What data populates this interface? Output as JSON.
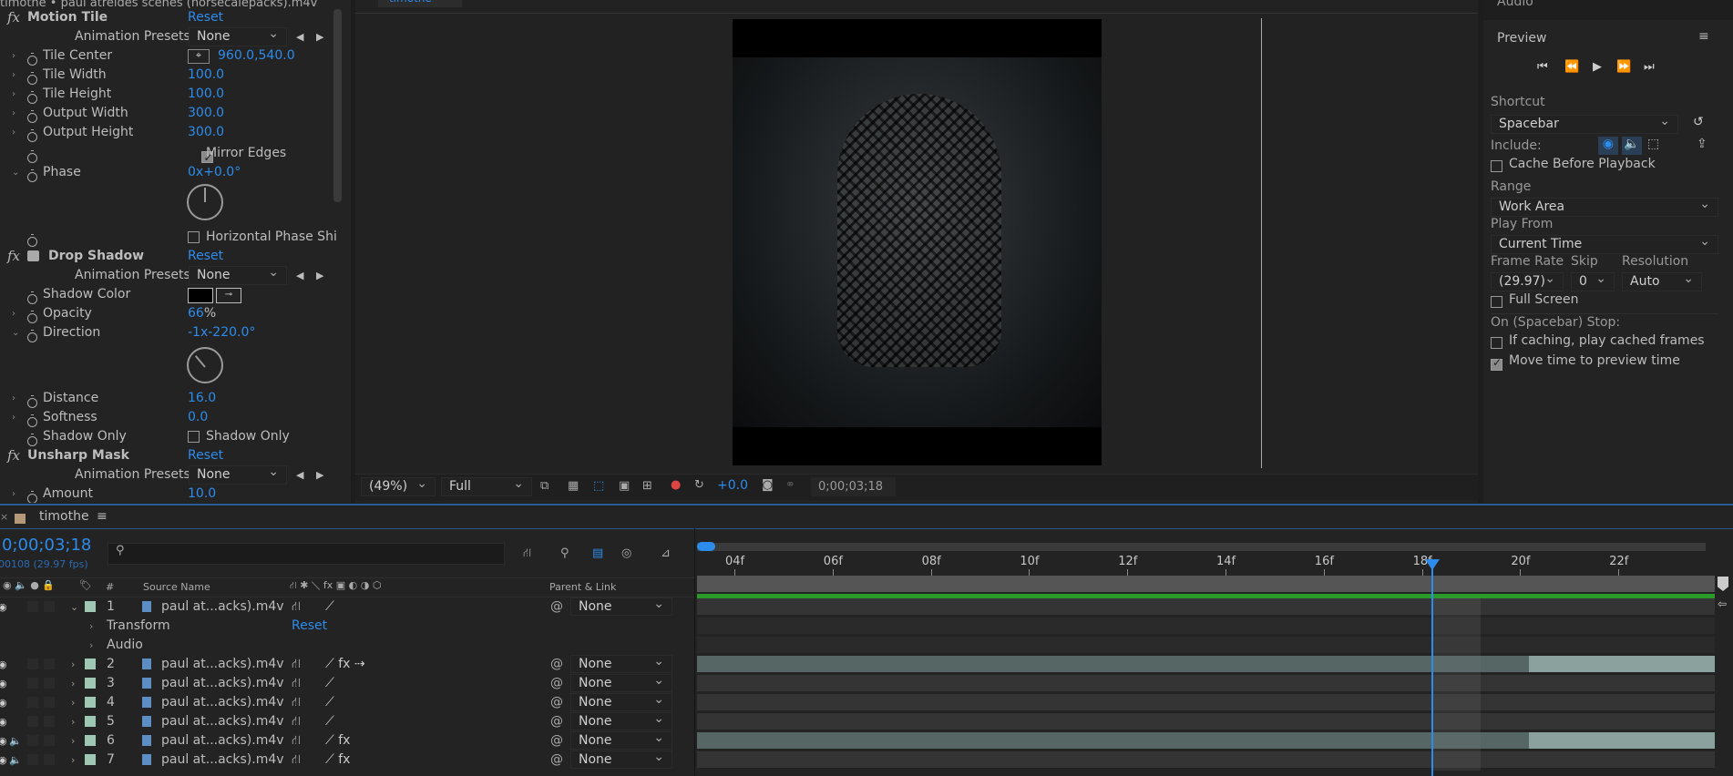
{
  "effect_controls": {
    "header": "timothe • paul atreides scenes (horsecalepacks).m4v",
    "motion_tile": {
      "name": "Motion Tile",
      "reset": "Reset",
      "presets_label": "Animation Presets:",
      "presets_value": "None",
      "props": [
        {
          "label": "Tile Center",
          "value": "960.0,540.0"
        },
        {
          "label": "Tile Width",
          "value": "100.0"
        },
        {
          "label": "Tile Height",
          "value": "100.0"
        },
        {
          "label": "Output Width",
          "value": "300.0"
        },
        {
          "label": "Output Height",
          "value": "300.0"
        }
      ],
      "mirror_edges": "Mirror Edges",
      "phase_label": "Phase",
      "phase_value": "0x+0.0°",
      "hphase": "Horizontal Phase Shi"
    },
    "drop_shadow": {
      "name": "Drop Shadow",
      "reset": "Reset",
      "presets_label": "Animation Presets:",
      "presets_value": "None",
      "shadow_color_label": "Shadow Color",
      "shadow_color": "#000000",
      "opacity_label": "Opacity",
      "opacity_value": "66",
      "opacity_unit": "%",
      "direction_label": "Direction",
      "direction_value": "-1x-220.0°",
      "distance_label": "Distance",
      "distance_value": "16.0",
      "softness_label": "Softness",
      "softness_value": "0.0",
      "shadow_only_label": "Shadow Only",
      "shadow_only_check": "Shadow Only"
    },
    "unsharp_mask": {
      "name": "Unsharp Mask",
      "reset": "Reset",
      "presets_label": "Animation Presets:",
      "presets_value": "None",
      "amount_label": "Amount",
      "amount_value": "10.0"
    }
  },
  "viewer": {
    "tab": "timothe",
    "zoom": "(49%)",
    "resolution": "Full",
    "exposure": "+0.0",
    "timecode": "0;00;03;18"
  },
  "preview": {
    "top_label": "Audio",
    "title": "Preview",
    "shortcut_label": "Shortcut",
    "shortcut_value": "Spacebar",
    "include_label": "Include:",
    "cache_before": "Cache Before Playback",
    "range_label": "Range",
    "range_value": "Work Area",
    "play_from_label": "Play From",
    "play_from_value": "Current Time",
    "frame_rate_label": "Frame Rate",
    "frame_rate_value": "(29.97)",
    "skip_label": "Skip",
    "skip_value": "0",
    "resolution_label": "Resolution",
    "resolution_value": "Auto",
    "full_screen": "Full Screen",
    "stop_label": "On (Spacebar) Stop:",
    "if_caching": "If caching, play cached frames",
    "move_time": "Move time to preview time"
  },
  "timeline": {
    "comp_name": "timothe",
    "timecode": "0;00;03;18",
    "fps": "00108 (29.97 fps)",
    "search_placeholder": "",
    "col_num": "#",
    "col_source": "Source Name",
    "col_parent": "Parent & Link",
    "ruler": [
      "04f",
      "06f",
      "08f",
      "10f",
      "12f",
      "14f",
      "16f",
      "18f",
      "20f",
      "22f"
    ],
    "layers": [
      {
        "num": "1",
        "name": "paul at...acks).m4v",
        "parent": "None"
      },
      {
        "num": "2",
        "name": "paul at...acks).m4v",
        "parent": "None"
      },
      {
        "num": "3",
        "name": "paul at...acks).m4v",
        "parent": "None"
      },
      {
        "num": "4",
        "name": "paul at...acks).m4v",
        "parent": "None"
      },
      {
        "num": "5",
        "name": "paul at...acks).m4v",
        "parent": "None"
      },
      {
        "num": "6",
        "name": "paul at...acks).m4v",
        "parent": "None"
      },
      {
        "num": "7",
        "name": "paul at...acks).m4v",
        "parent": "None"
      }
    ],
    "transform_label": "Transform",
    "transform_reset": "Reset",
    "audio_label": "Audio"
  }
}
